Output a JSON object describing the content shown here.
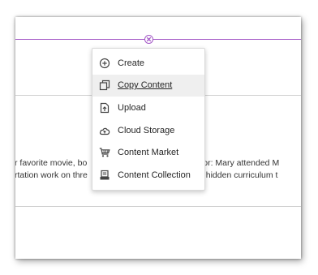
{
  "menu": {
    "items": [
      {
        "label": "Create",
        "icon": "plus-circle-icon"
      },
      {
        "label": "Copy Content",
        "icon": "copy-icon"
      },
      {
        "label": "Upload",
        "icon": "upload-icon"
      },
      {
        "label": "Cloud Storage",
        "icon": "cloud-icon"
      },
      {
        "label": "Content Market",
        "icon": "cart-icon"
      },
      {
        "label": "Content Collection",
        "icon": "archive-icon"
      }
    ],
    "highlighted_item": "Copy Content"
  },
  "body": {
    "line1": "r favorite movie, bo                                          tructor: Mary attended M",
    "line2": "rtation work on thre                                          f the hidden curriculum t"
  },
  "colors": {
    "accent": "#a357c6",
    "divider": "#cfcfcf",
    "menu_hover": "#efefef"
  }
}
